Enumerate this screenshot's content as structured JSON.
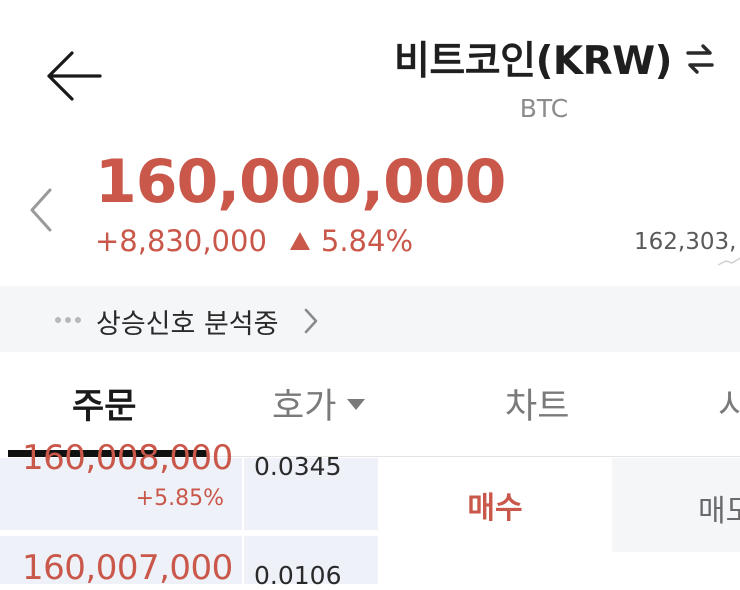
{
  "header": {
    "title": "비트코인(KRW)",
    "symbol": "BTC",
    "back_icon": "arrow-left-icon",
    "swap_icon": "swap-arrows-icon"
  },
  "ticker": {
    "price": "160,000,000",
    "change_amount": "+8,830,000",
    "change_percent": "5.84%",
    "direction": "up",
    "high_price": "162,303,"
  },
  "signal": {
    "text": "상승신호 분석중"
  },
  "tabs": [
    {
      "label": "주문",
      "active": true
    },
    {
      "label": "호가",
      "has_dropdown": true
    },
    {
      "label": "차트"
    },
    {
      "label": "시"
    }
  ],
  "orderbook": {
    "rows": [
      {
        "price": "160,008,000",
        "change": "+5.85%",
        "qty": "0.0345"
      },
      {
        "price": "160,007,000",
        "qty": "0.0106"
      }
    ]
  },
  "order_form": {
    "buy_label": "매수",
    "sell_label": "매도"
  },
  "colors": {
    "up": "#c9574a",
    "banner_bg": "#f5f6f8",
    "orderbook_bg": "#eef1f8"
  }
}
